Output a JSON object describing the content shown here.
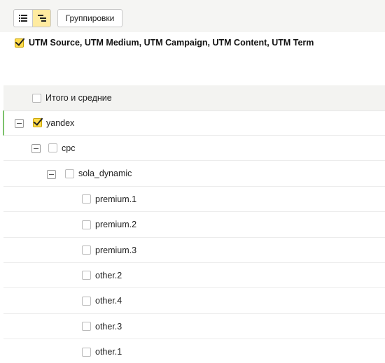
{
  "toolbar": {
    "view_list_icon": "list-icon",
    "view_tree_icon": "tree-icon",
    "groupings_label": "Группировки"
  },
  "grouping": {
    "checked": true,
    "label": "UTM Source, UTM Medium, UTM Campaign, UTM Content, UTM Term"
  },
  "totals": {
    "label": "Итого и средние",
    "checked": false
  },
  "colors": {
    "accent": "#ffdb4d",
    "active_row_marker": "#7cc26b"
  },
  "tree": [
    {
      "label": "yandex",
      "level": 0,
      "expanded": true,
      "checked": true
    },
    {
      "label": "cpc",
      "level": 1,
      "expanded": true,
      "checked": false
    },
    {
      "label": "sola_dynamic",
      "level": 2,
      "expanded": true,
      "checked": false
    },
    {
      "label": "premium.1",
      "level": 3,
      "checked": false
    },
    {
      "label": "premium.2",
      "level": 3,
      "checked": false
    },
    {
      "label": "premium.3",
      "level": 3,
      "checked": false
    },
    {
      "label": "other.2",
      "level": 3,
      "checked": false
    },
    {
      "label": "other.4",
      "level": 3,
      "checked": false
    },
    {
      "label": "other.3",
      "level": 3,
      "checked": false
    },
    {
      "label": "other.1",
      "level": 3,
      "checked": false
    }
  ]
}
